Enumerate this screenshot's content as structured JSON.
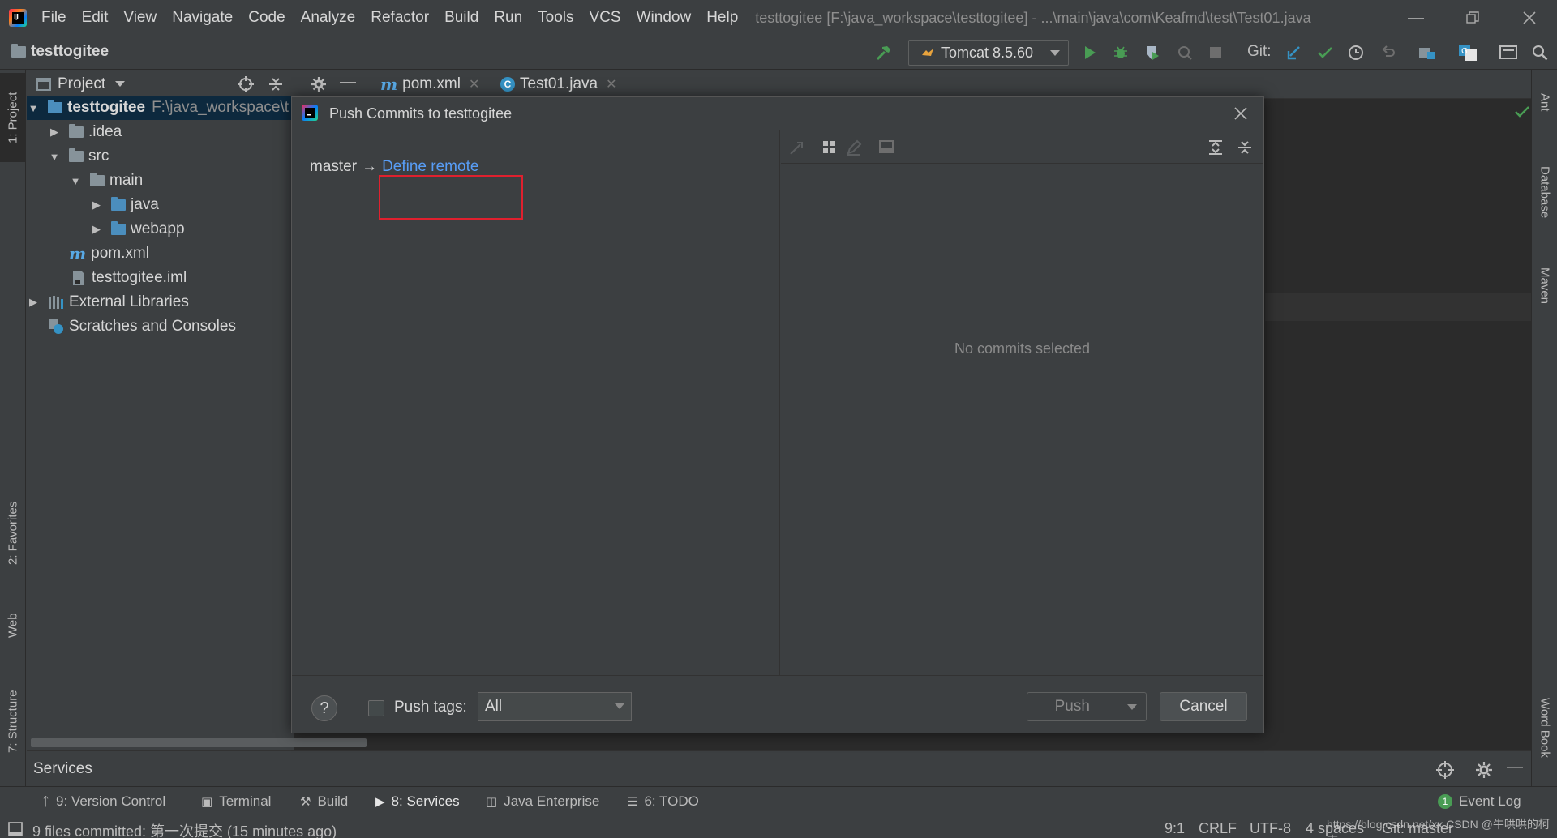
{
  "menu": {
    "items": [
      "File",
      "Edit",
      "View",
      "Navigate",
      "Code",
      "Analyze",
      "Refactor",
      "Build",
      "Run",
      "Tools",
      "VCS",
      "Window",
      "Help"
    ],
    "window_title": "testtogitee [F:\\java_workspace\\testtogitee] - ...\\main\\java\\com\\Keafmd\\test\\Test01.java"
  },
  "navbar": {
    "project_name": "testtogitee",
    "run_config": "Tomcat 8.5.60",
    "git_label": "Git:"
  },
  "project_panel": {
    "header": "Project",
    "tree": [
      {
        "label": "testtogitee",
        "path": "F:\\java_workspace\\t"
      },
      {
        "label": ".idea"
      },
      {
        "label": "src"
      },
      {
        "label": "main"
      },
      {
        "label": "java"
      },
      {
        "label": "webapp"
      },
      {
        "label": "pom.xml"
      },
      {
        "label": "testtogitee.iml"
      },
      {
        "label": "External Libraries"
      },
      {
        "label": "Scratches and Consoles"
      }
    ]
  },
  "editor_tabs": [
    {
      "label": "pom.xml"
    },
    {
      "label": "Test01.java"
    }
  ],
  "left_tool_tabs": [
    "1: Project",
    "2: Favorites",
    "Web",
    "7: Structure"
  ],
  "right_tool_tabs": [
    "Ant",
    "Database",
    "Maven",
    "Word Book"
  ],
  "dialog": {
    "title": "Push Commits to testtogitee",
    "branch": "master",
    "arrow": "→",
    "define_remote": "Define remote",
    "no_commits": "No commits selected",
    "help": "?",
    "push_tags_label": "Push tags:",
    "push_tags_value": "All",
    "push_label": "Push",
    "cancel_label": "Cancel"
  },
  "services": {
    "label": "Services"
  },
  "bottom_tools": [
    {
      "label": "9: Version Control"
    },
    {
      "label": "Terminal"
    },
    {
      "label": "Build"
    },
    {
      "label": "8: Services"
    },
    {
      "label": "Java Enterprise"
    },
    {
      "label": "6: TODO"
    },
    {
      "label": "Event Log"
    }
  ],
  "status": {
    "message": "9 files committed: 第一次提交 (15 minutes ago)",
    "position": "9:1",
    "line_sep": "CRLF",
    "encoding": "UTF-8",
    "indent": "4 spaces",
    "git_branch": "Git: master",
    "watermark": "https://blog.csdn.net/xx CSDN @牛哄哄的柯南"
  },
  "colors": {
    "background": "#3c3f41",
    "editor": "#2b2b2b",
    "link": "#589df6",
    "highlight_box": "#e0202e",
    "run_green": "#499c54",
    "git_blue": "#3592c4"
  }
}
